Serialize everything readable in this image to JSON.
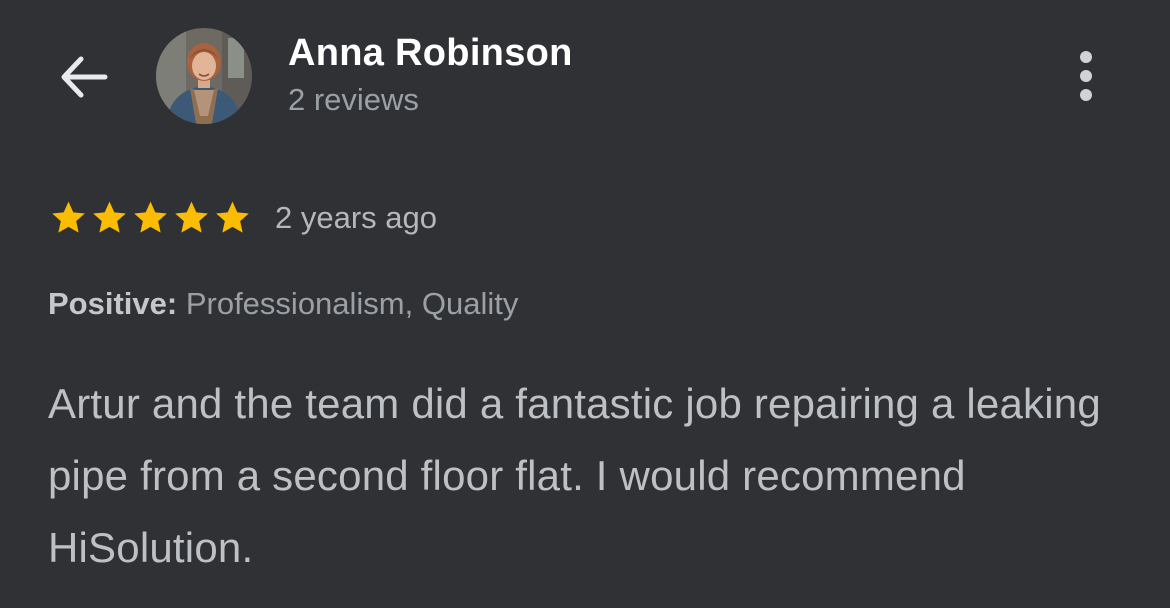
{
  "header": {
    "back_icon": "arrow-back-icon",
    "avatar_icon": "reviewer-avatar",
    "reviewer_name": "Anna Robinson",
    "review_count": "2 reviews",
    "more_icon": "more-vert-icon"
  },
  "review": {
    "rating": 5,
    "rating_max": 5,
    "star_color": "#fbbc04",
    "time": "2 years ago",
    "tags_label": "Positive:",
    "tags_values": " Professionalism, Quality",
    "text": "Artur and the team did a fantastic job repairing a leaking pipe from a second floor flat. I would recommend HiSolution."
  }
}
